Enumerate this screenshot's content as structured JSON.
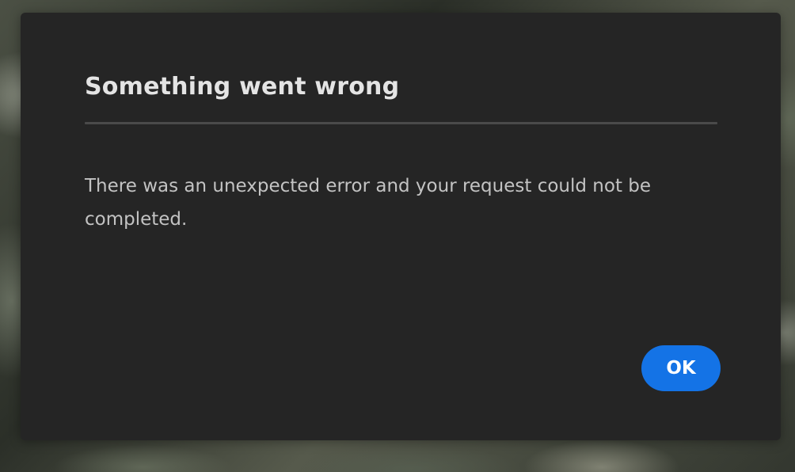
{
  "dialog": {
    "title": "Something went wrong",
    "message": "There was an unexpected error and your request could not be completed.",
    "ok_label": "OK"
  },
  "colors": {
    "dialog_background": "#252525",
    "title_text": "#e4e4e4",
    "body_text": "#c3c3c3",
    "divider": "#4a4a4a",
    "button_accent": "#1473e6"
  }
}
